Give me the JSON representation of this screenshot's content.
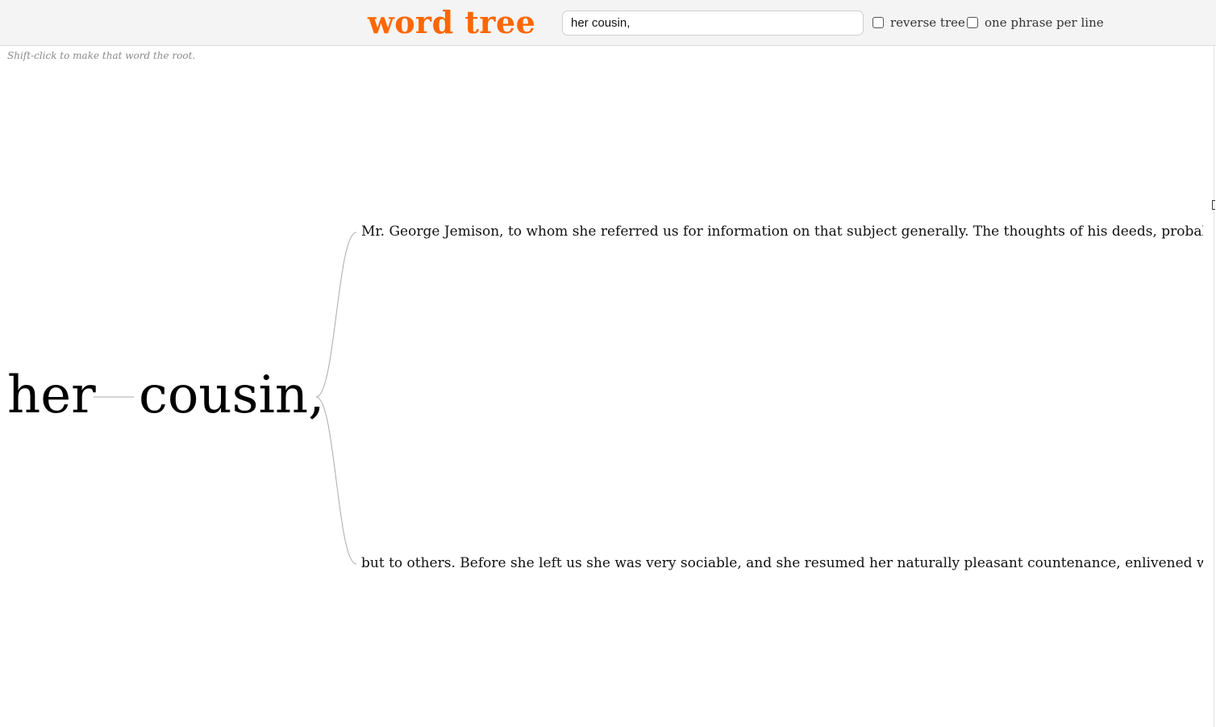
{
  "app": {
    "logo": "word tree",
    "logo_color": "#ff6600"
  },
  "search": {
    "value": "her cousin,"
  },
  "options": {
    "reverse_tree": {
      "label": "reverse tree",
      "checked": false
    },
    "one_phrase_per_line": {
      "label": "one phrase per line",
      "checked": false
    }
  },
  "hint": "Shift-click to make that word the root.",
  "tree": {
    "root_words": [
      "her",
      "cousin,"
    ],
    "branches": [
      "Mr. George Jemison, to whom she referred us for information on that subject generally. The thoughts of his deeds, probably ch",
      "but to others. Before she left us she was very sociable, and she resumed her naturally pleasant countenance, enlivened with a sı"
    ],
    "connector_color": "#aaaaaa"
  }
}
